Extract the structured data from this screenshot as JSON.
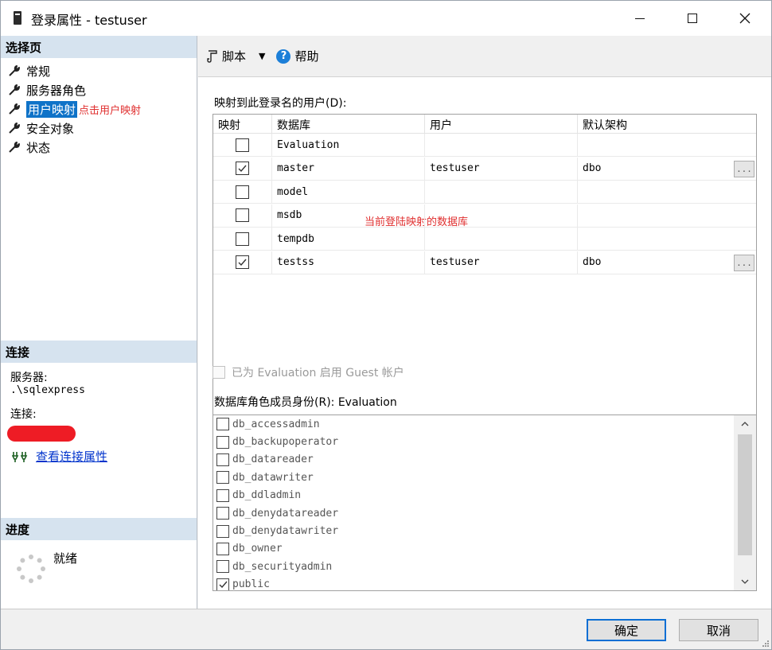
{
  "window": {
    "title": "登录属性 - testuser"
  },
  "left": {
    "select_page_title": "选择页",
    "pages": [
      {
        "label": "常规",
        "selected": false,
        "note": ""
      },
      {
        "label": "服务器角色",
        "selected": false,
        "note": ""
      },
      {
        "label": "用户映射",
        "selected": true,
        "note": "点击用户映射"
      },
      {
        "label": "安全对象",
        "selected": false,
        "note": ""
      },
      {
        "label": "状态",
        "selected": false,
        "note": ""
      }
    ],
    "connection_title": "连接",
    "server_label": "服务器:",
    "server_value": ".\\sqlexpress",
    "connection_label": "连接:",
    "view_connection_link": "查看连接属性",
    "progress_title": "进度",
    "progress_status": "就绪"
  },
  "toolbar": {
    "script_label": "脚本",
    "help_label": "帮助"
  },
  "mapping": {
    "label": "映射到此登录名的用户(D):",
    "columns": [
      "映射",
      "数据库",
      "用户",
      "默认架构"
    ],
    "rows": [
      {
        "mapped": false,
        "database": "Evaluation",
        "user": "",
        "schema": "",
        "has_button": false
      },
      {
        "mapped": true,
        "database": "master",
        "user": "testuser",
        "schema": "dbo",
        "has_button": true
      },
      {
        "mapped": false,
        "database": "model",
        "user": "",
        "schema": "",
        "has_button": false
      },
      {
        "mapped": false,
        "database": "msdb",
        "user": "",
        "schema": "",
        "has_button": false
      },
      {
        "mapped": false,
        "database": "tempdb",
        "user": "",
        "schema": "",
        "has_button": false
      },
      {
        "mapped": true,
        "database": "testss",
        "user": "testuser",
        "schema": "dbo",
        "has_button": true
      }
    ],
    "annotation": "当前登陆映射的数据库",
    "ellipsis": "..."
  },
  "guest": {
    "label": "已为 Evaluation 启用 Guest 帐户",
    "checked": false,
    "enabled": false
  },
  "roles": {
    "label": "数据库角色成员身份(R): Evaluation",
    "items": [
      {
        "name": "db_accessadmin",
        "checked": false
      },
      {
        "name": "db_backupoperator",
        "checked": false
      },
      {
        "name": "db_datareader",
        "checked": false
      },
      {
        "name": "db_datawriter",
        "checked": false
      },
      {
        "name": "db_ddladmin",
        "checked": false
      },
      {
        "name": "db_denydatareader",
        "checked": false
      },
      {
        "name": "db_denydatawriter",
        "checked": false
      },
      {
        "name": "db_owner",
        "checked": false
      },
      {
        "name": "db_securityadmin",
        "checked": false
      },
      {
        "name": "public",
        "checked": true
      }
    ]
  },
  "buttons": {
    "ok": "确定",
    "cancel": "取消"
  },
  "colors": {
    "accent": "#0f73c8",
    "annotation": "#e03030",
    "section_header": "#d6e3ef",
    "link": "#0033cc"
  }
}
